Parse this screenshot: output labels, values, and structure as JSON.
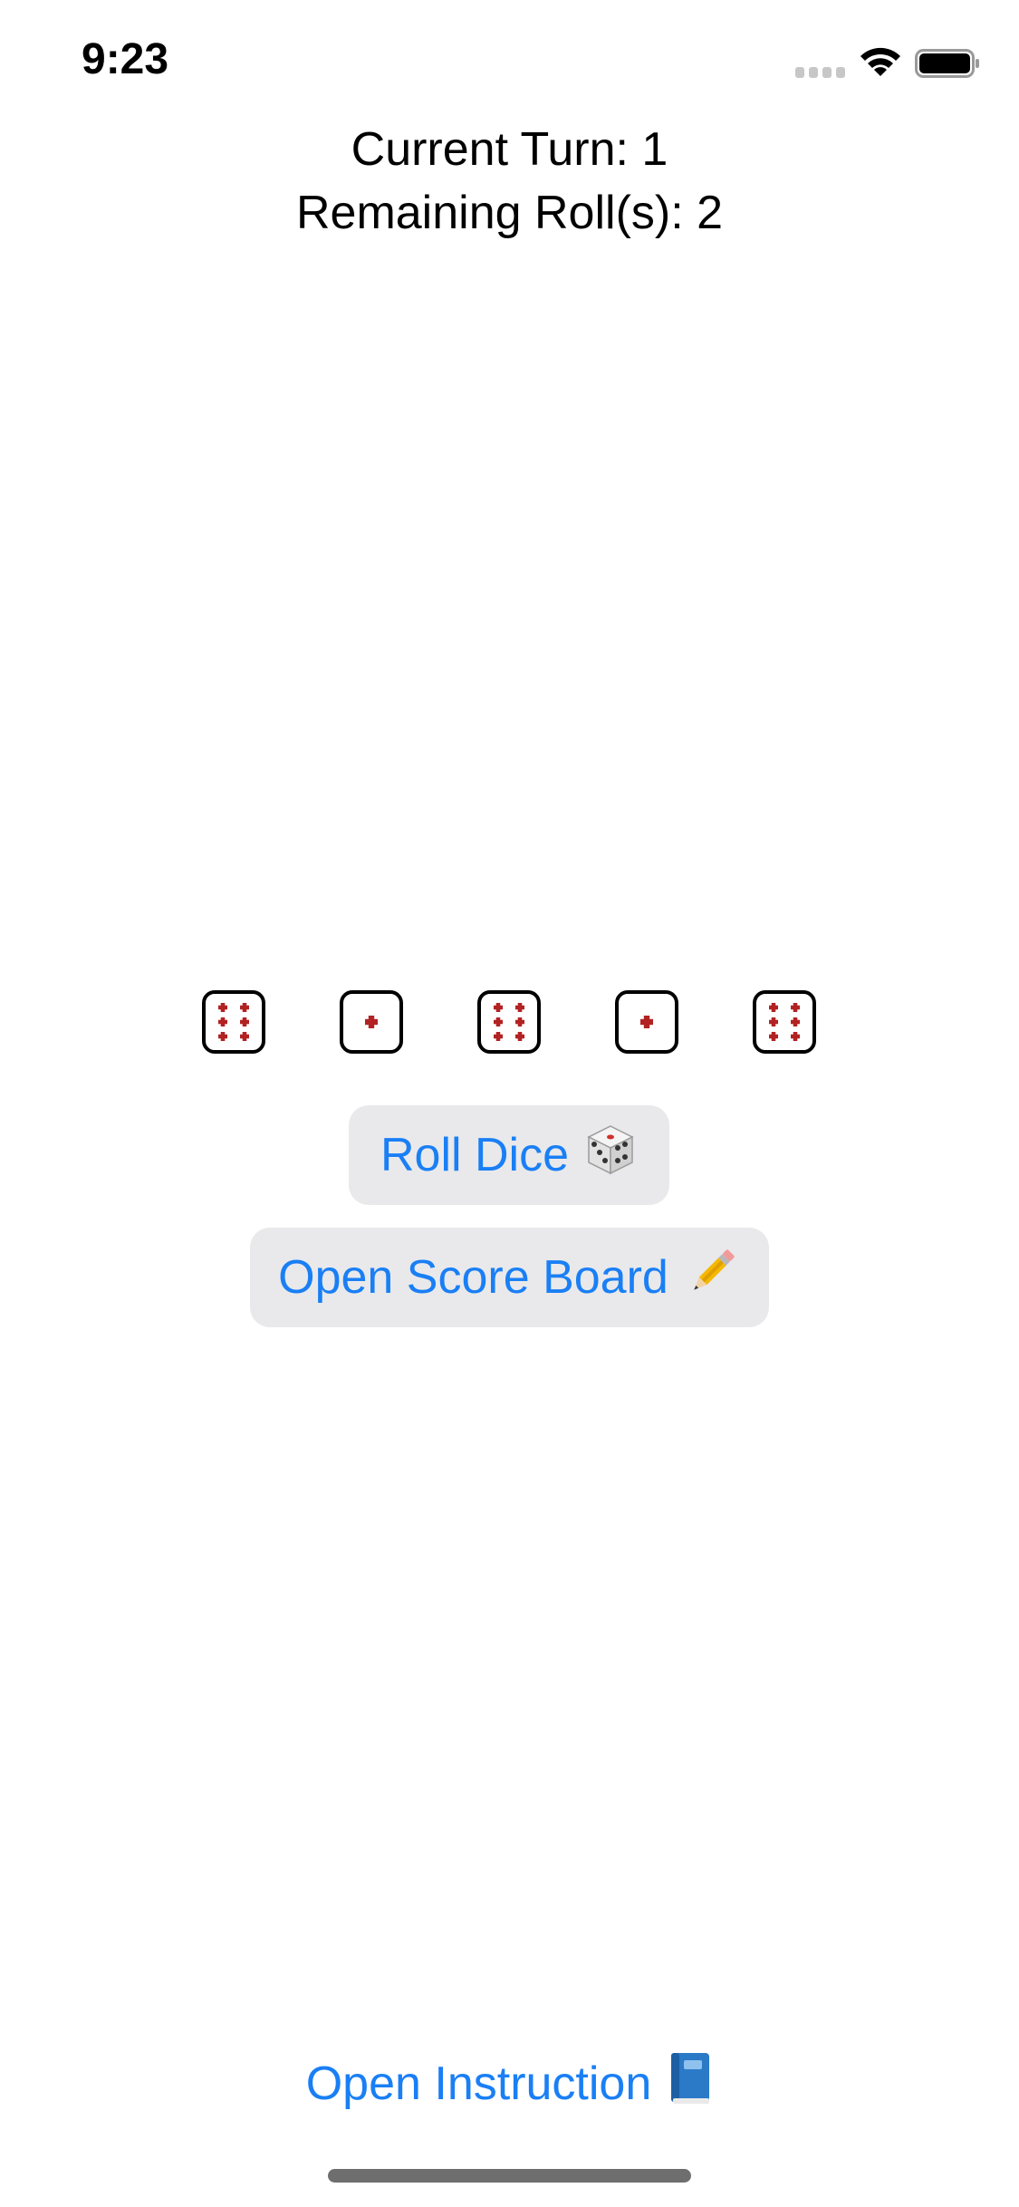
{
  "status_bar": {
    "time": "9:23",
    "icons": [
      "signal-icon",
      "wifi-icon",
      "battery-icon"
    ]
  },
  "game": {
    "turn_label": "Current Turn: 1",
    "rolls_label": "Remaining Roll(s): 2"
  },
  "dice": [
    {
      "value": 6
    },
    {
      "value": 1
    },
    {
      "value": 6
    },
    {
      "value": 1
    },
    {
      "value": 6
    }
  ],
  "colors": {
    "pip": "#b22222",
    "accent": "#1a7ff5",
    "button_bg": "#e9e9eb"
  },
  "buttons": {
    "roll_dice_label": "Roll Dice",
    "roll_dice_icon": "die-icon",
    "score_board_label": "Open Score Board",
    "score_board_icon": "pencil-icon",
    "instruction_label": "Open Instruction",
    "instruction_icon": "book-icon"
  }
}
